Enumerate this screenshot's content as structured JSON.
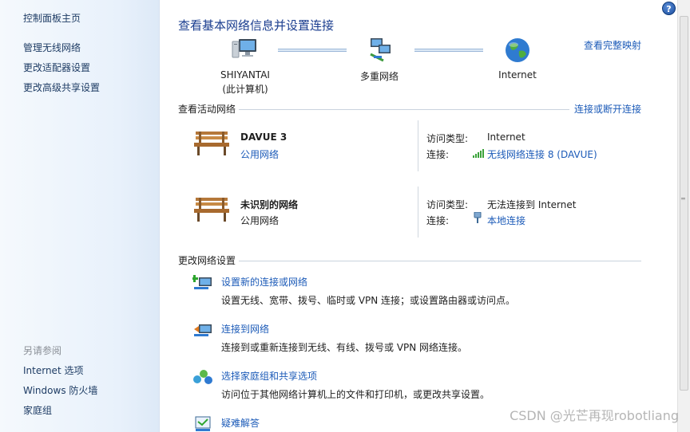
{
  "sidebar": {
    "home_link": "控制面板主页",
    "links": [
      "管理无线网络",
      "更改适配器设置",
      "更改高级共享设置"
    ],
    "see_also_title": "另请参阅",
    "see_also": [
      "Internet 选项",
      "Windows 防火墙",
      "家庭组"
    ]
  },
  "header": {
    "title": "查看基本网络信息并设置连接",
    "full_map_link": "查看完整映射",
    "help_icon": "?"
  },
  "map": {
    "computer_name": "SHIYANTAI",
    "computer_sub": "(此计算机)",
    "middle": "多重网络",
    "internet": "Internet"
  },
  "active": {
    "title": "查看活动网络",
    "connect_link": "连接或断开连接",
    "networks": [
      {
        "name": "DAVUE  3",
        "type": "公用网络",
        "access_label": "访问类型:",
        "access_value": "Internet",
        "conn_label": "连接:",
        "conn_value": "无线网络连接 8 (DAVUE)"
      },
      {
        "name": "未识别的网络",
        "type": "公用网络",
        "access_label": "访问类型:",
        "access_value": "无法连接到 Internet",
        "conn_label": "连接:",
        "conn_value": "本地连接"
      }
    ]
  },
  "change": {
    "title": "更改网络设置",
    "tasks": [
      {
        "title": "设置新的连接或网络",
        "desc": "设置无线、宽带、拨号、临时或 VPN 连接；或设置路由器或访问点。"
      },
      {
        "title": "连接到网络",
        "desc": "连接到或重新连接到无线、有线、拨号或 VPN 网络连接。"
      },
      {
        "title": "选择家庭组和共享选项",
        "desc": "访问位于其他网络计算机上的文件和打印机，或更改共享设置。"
      },
      {
        "title": "疑难解答",
        "desc": ""
      }
    ]
  },
  "watermark": "CSDN @光芒再现robotliang"
}
